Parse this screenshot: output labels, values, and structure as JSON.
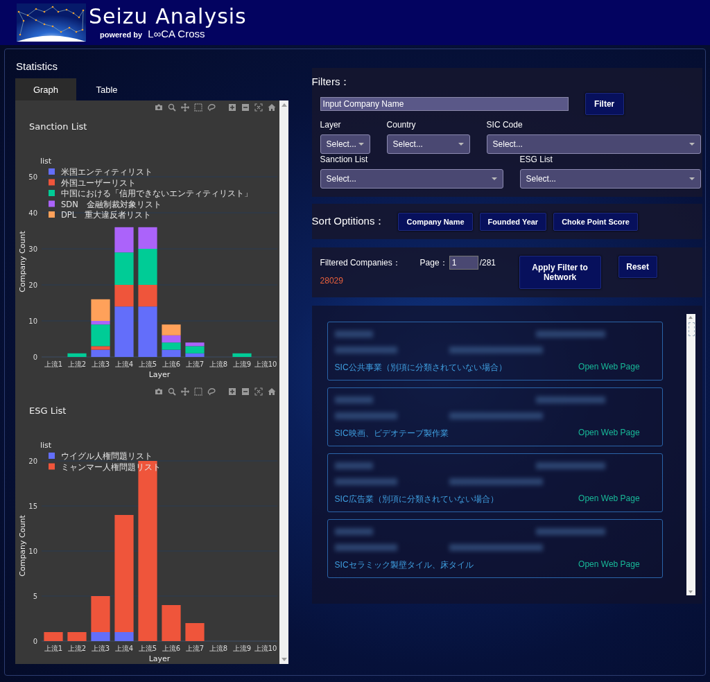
{
  "header": {
    "title": "Seizu Analysis",
    "powered_by": "powered by",
    "brand": "L∞CA Cross"
  },
  "statistics": {
    "heading": "Statistics",
    "tabs": [
      {
        "label": "Graph",
        "selected": true
      },
      {
        "label": "Table",
        "selected": false
      }
    ],
    "charts": [
      {
        "chart_data": {
          "type": "bar",
          "title": "Sanction List",
          "xlabel": "Layer",
          "ylabel": "Company Count",
          "stacked": true,
          "categories": [
            "上流1",
            "上流2",
            "上流3",
            "上流4",
            "上流5",
            "上流6",
            "上流7",
            "上流8",
            "上流9",
            "上流10"
          ],
          "grid": true,
          "legend": {
            "title": "list"
          },
          "ylim": [
            0,
            50
          ],
          "yticks": [
            0,
            10,
            20,
            30,
            40,
            50
          ],
          "series": [
            {
              "name": "米国エンティティリスト",
              "color": "#636efa",
              "values": [
                0,
                0,
                2,
                14,
                14,
                2,
                1,
                0,
                0,
                0
              ]
            },
            {
              "name": "外国ユーザーリスト",
              "color": "#ef553b",
              "values": [
                0,
                0,
                1,
                6,
                6,
                0,
                0,
                0,
                0,
                0
              ]
            },
            {
              "name": "中国における「信用できないエンティティリスト」",
              "color": "#00cc96",
              "values": [
                0,
                1,
                6,
                9,
                10,
                2,
                2,
                0,
                1,
                0
              ]
            },
            {
              "name": "SDN　金融制裁対象リスト",
              "color": "#ab63fa",
              "values": [
                0,
                0,
                1,
                7,
                6,
                2,
                1,
                0,
                0,
                0
              ]
            },
            {
              "name": "DPL　重大違反者リスト",
              "color": "#ffa15a",
              "values": [
                0,
                0,
                6,
                0,
                0,
                3,
                0,
                0,
                0,
                0
              ]
            }
          ]
        }
      },
      {
        "chart_data": {
          "type": "bar",
          "title": "ESG List",
          "xlabel": "Layer",
          "ylabel": "Company Count",
          "stacked": true,
          "categories": [
            "上流1",
            "上流2",
            "上流3",
            "上流4",
            "上流5",
            "上流6",
            "上流7",
            "上流8",
            "上流9",
            "上流10"
          ],
          "grid": true,
          "legend": {
            "title": "list"
          },
          "ylim": [
            0,
            20
          ],
          "yticks": [
            0,
            5,
            10,
            15,
            20
          ],
          "series": [
            {
              "name": "ウイグル人権問題リスト",
              "color": "#636efa",
              "values": [
                0,
                0,
                1,
                1,
                0,
                0,
                0,
                0,
                0,
                0
              ]
            },
            {
              "name": "ミャンマー人権問題リスト",
              "color": "#ef553b",
              "values": [
                1,
                1,
                4,
                13,
                20,
                4,
                2,
                0,
                0,
                0
              ]
            }
          ]
        }
      }
    ]
  },
  "filters": {
    "heading": "Filters：",
    "company_name": {
      "placeholder": "Input Company Name"
    },
    "filter_button": "Filter",
    "dropdowns": [
      {
        "label": "Layer",
        "placeholder": "Select..."
      },
      {
        "label": "Country",
        "placeholder": "Select..."
      },
      {
        "label": "SIC Code",
        "placeholder": "Select..."
      },
      {
        "label": "Sanction List",
        "placeholder": "Select..."
      },
      {
        "label": "ESG List",
        "placeholder": "Select..."
      }
    ]
  },
  "sort": {
    "heading": "Sort Optitions：",
    "buttons": [
      "Company Name",
      "Founded Year",
      "Choke Point Score"
    ]
  },
  "summary": {
    "filtered_label": "Filtered Companies：",
    "filtered_count": "28029",
    "page_label": "Page：",
    "page": "1",
    "page_total": "/281",
    "apply_button": "Apply Filter to Network",
    "reset_button": "Reset"
  },
  "companies": [
    {
      "sic": "SIC公共事業（別項に分類されていない場合）",
      "link": "Open Web Page"
    },
    {
      "sic": "SIC映画、ビデオテープ製作業",
      "link": "Open Web Page"
    },
    {
      "sic": "SIC広告業（別項に分類されていない場合）",
      "link": "Open Web Page"
    },
    {
      "sic": "SICセラミック製壁タイル、床タイル",
      "link": "Open Web Page"
    }
  ]
}
